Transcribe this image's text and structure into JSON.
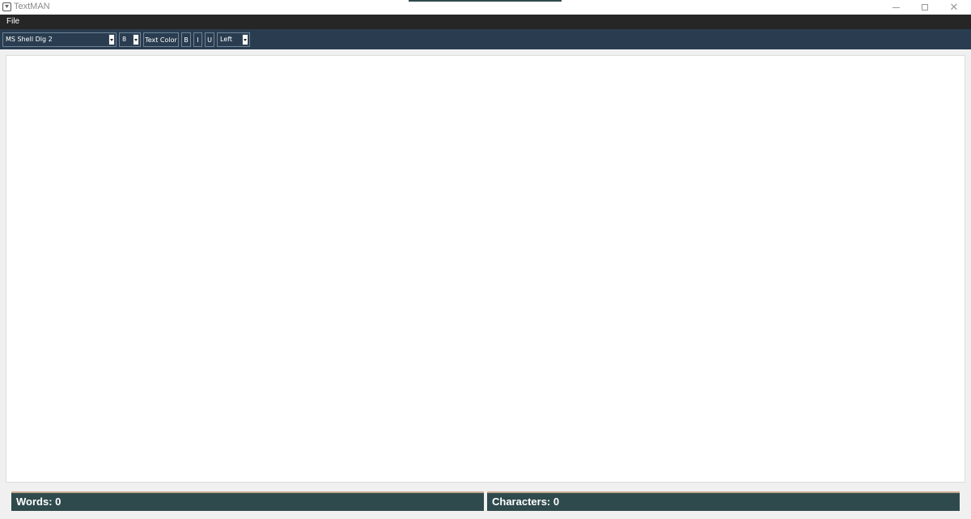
{
  "window": {
    "title": "TextMAN",
    "close_glyph": "✕"
  },
  "menu": {
    "file_label": "File"
  },
  "toolbar": {
    "font_name": "MS Shell Dlg 2",
    "font_size": "8",
    "text_color_label": "Text Color",
    "bold_label": "B",
    "italic_label": "I",
    "underline_label": "U",
    "alignment": "Left"
  },
  "editor": {
    "content": ""
  },
  "status": {
    "words": "Words: 0",
    "characters": "Characters: 0"
  },
  "colors": {
    "menubar": "#262626",
    "toolbar": "#2a3d50",
    "status": "#2f4a4c",
    "status_border": "#c9a98e"
  }
}
